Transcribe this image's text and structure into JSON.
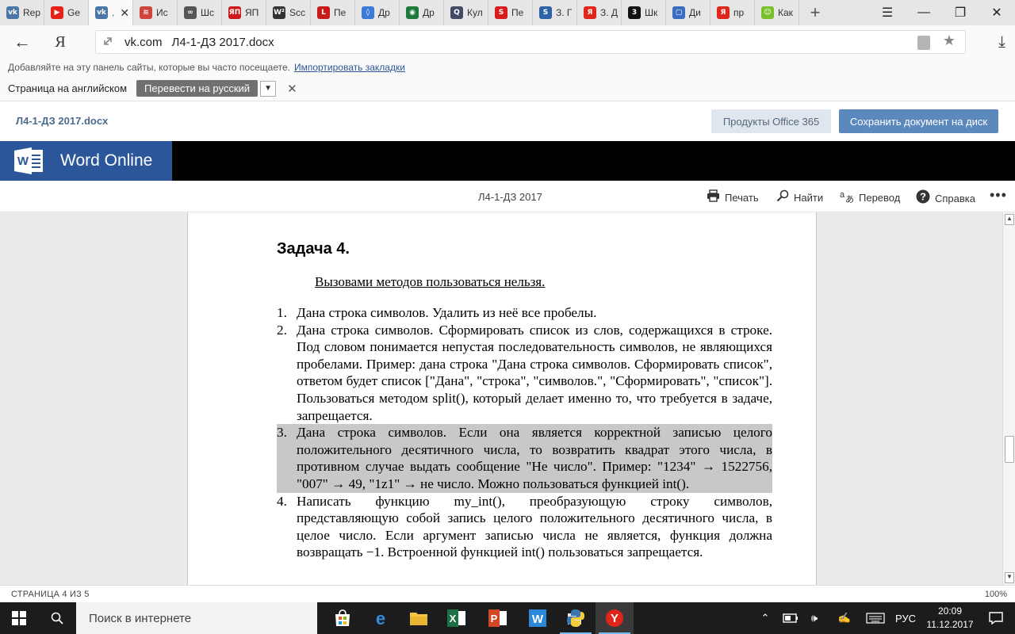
{
  "browser": {
    "tabs": [
      {
        "label": "Rep",
        "favicon_color": "#4a76a8",
        "favicon_text": "vk"
      },
      {
        "label": "Ge",
        "favicon_color": "#e62117",
        "favicon_text": "▶"
      },
      {
        "label": ".",
        "favicon_color": "#4a76a8",
        "favicon_text": "vk",
        "active": true
      },
      {
        "label": "Ис",
        "favicon_color": "#d0453b",
        "favicon_text": "≋"
      },
      {
        "label": "Шс",
        "favicon_color": "#555555",
        "favicon_text": "∞"
      },
      {
        "label": "ЯП",
        "favicon_color": "#cc1a1a",
        "favicon_text": "ЯП"
      },
      {
        "label": "Scc",
        "favicon_color": "#333333",
        "favicon_text": "W²"
      },
      {
        "label": "Пе",
        "favicon_color": "#c91b1b",
        "favicon_text": "L"
      },
      {
        "label": "Др",
        "favicon_color": "#3c7ad9",
        "favicon_text": "◊"
      },
      {
        "label": "Др",
        "favicon_color": "#1b7a3a",
        "favicon_text": "◉"
      },
      {
        "label": "Кул",
        "favicon_color": "#444a66",
        "favicon_text": "Q"
      },
      {
        "label": "Пе",
        "favicon_color": "#d61c1c",
        "favicon_text": "S"
      },
      {
        "label": "З. Г",
        "favicon_color": "#2f63a8",
        "favicon_text": "S"
      },
      {
        "label": "З. Д",
        "favicon_color": "#e0251b",
        "favicon_text": "Я"
      },
      {
        "label": "Шк",
        "favicon_color": "#111111",
        "favicon_text": "3"
      },
      {
        "label": "Ди",
        "favicon_color": "#3a6cbf",
        "favicon_text": "▢"
      },
      {
        "label": "пр",
        "favicon_color": "#e0251b",
        "favicon_text": "Я"
      },
      {
        "label": "Как",
        "favicon_color": "#7bbf2a",
        "favicon_text": "☺"
      }
    ],
    "new_tab_icon": "+",
    "url_domain": "vk.com",
    "url_title": "Л4-1-ДЗ 2017.docx",
    "bookmarks_hint": "Добавляйте на эту панель сайты, которые вы часто посещаете.",
    "bookmarks_link": "Импортировать закладки",
    "translate_prompt": "Страница на английском",
    "translate_button": "Перевести на русский"
  },
  "vk": {
    "doc_name": "Л4-1-ДЗ 2017.docx",
    "office_button": "Продукты Office 365",
    "save_button": "Сохранить документ на диск"
  },
  "word": {
    "brand": "Word Online",
    "doc_title": "Л4-1-ДЗ 2017",
    "toolbar": {
      "print": "Печать",
      "find": "Найти",
      "translate": "Перевод",
      "help": "Справка",
      "more": "•••"
    },
    "document": {
      "heading": "Задача 4.",
      "note": "Вызовами методов пользоваться нельзя.",
      "items": [
        {
          "num": "1.",
          "text": "Дана строка символов. Удалить из неё все пробелы."
        },
        {
          "num": "2.",
          "text": "Дана строка символов. Сформировать список из слов, содержащихся в строке. Под словом понимается непустая последовательность символов, не являющихся пробелами. Пример: дана строка \"Дана строка символов. Сформировать список\", ответом будет список [\"Дана\", \"строка\", \"символов.\", \"Сформировать\", \"список\"]. Пользоваться методом split(), который делает именно то, что требуется в задаче, запрещается."
        },
        {
          "num": "3.",
          "text": "Дана строка символов. Если она является корректной записью целого положительного десятичного числа, то возвратить квадрат этого числа, в противном случае выдать сообщение \"Не число\". Пример: \"1234\" → 1522756, \"007\" → 49, \"1z1\" → не число. Можно пользоваться функцией int().",
          "highlighted": true
        },
        {
          "num": "4.",
          "text": "Написать функцию my_int(), преобразующую строку символов, представляющую собой запись целого положительного десятичного числа, в целое число. Если аргумент записью числа не является, функция должна возвращать −1. Встроенной функцией int() пользоваться запрещается."
        }
      ]
    },
    "status": {
      "page": "СТРАНИЦА 4 ИЗ 5",
      "zoom": "100%"
    }
  },
  "taskbar": {
    "search_placeholder": "Поиск в интернете",
    "language": "РУС",
    "time": "20:09",
    "date": "11.12.2017"
  }
}
